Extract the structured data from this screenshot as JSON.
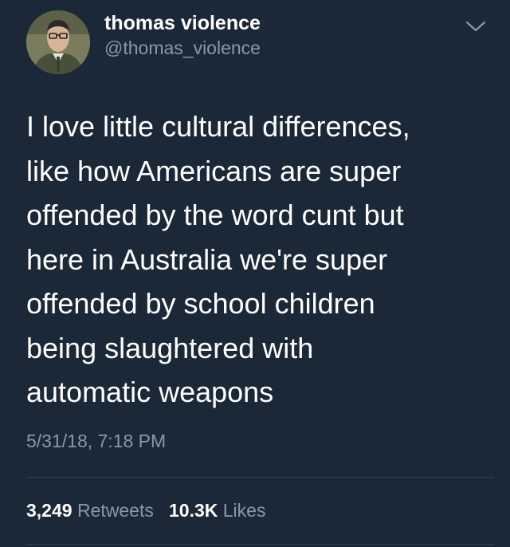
{
  "user": {
    "display_name": "thomas violence",
    "handle": "@thomas_violence"
  },
  "tweet": {
    "lines": [
      "I love little cultural differences,",
      "like how Americans are super",
      "offended by the word cunt but",
      "here in Australia we're super",
      "offended by school children",
      "being slaughtered with",
      "automatic weapons"
    ],
    "timestamp": "5/31/18, 7:18 PM"
  },
  "stats": {
    "retweets_count": "3,249",
    "retweets_label": "Retweets",
    "likes_count": "10.3K",
    "likes_label": "Likes"
  },
  "icons": {
    "menu": "chevron-down-icon"
  },
  "colors": {
    "background": "#1b2838",
    "text_primary": "#ffffff",
    "text_secondary": "#8899a6",
    "divider": "#38444d"
  }
}
